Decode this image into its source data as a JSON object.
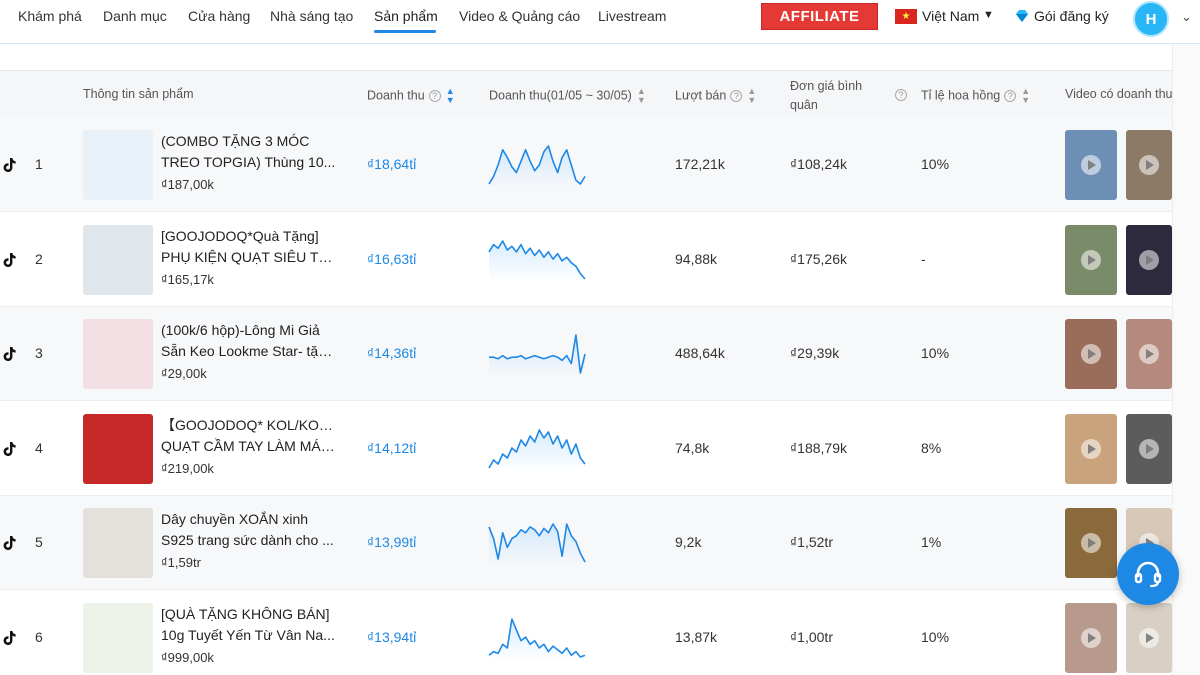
{
  "nav": {
    "items": [
      "Khám phá",
      "Danh mục",
      "Cửa hàng",
      "Nhà sáng tạo",
      "Sản phẩm",
      "Video & Quảng cáo",
      "Livestream"
    ],
    "active": "Sản phẩm",
    "affiliate_label": "AFFILIATE",
    "country": "Việt Nam",
    "plan_label": "Gói đăng ký",
    "avatar_letter": "H"
  },
  "table": {
    "headers": {
      "product_info": "Thông tin sản phẩm",
      "revenue": "Doanh thu",
      "revenue_period": "Doanh thu(01/05 ~ 30/05)",
      "sold": "Lượt bán",
      "unit_price_line1": "Đơn giá bình",
      "unit_price_line2": "quân",
      "commission": "Tỉ lệ hoa hồng",
      "video": "Video có doanh thu"
    },
    "rows": [
      {
        "rank": "1",
        "name_line1": "(COMBO TẶNG 3 MÓC",
        "name_line2": "TREO TOPGIA) Thùng 10...",
        "price": "₫187,00k",
        "revenue": "₫18,64tỉ",
        "trend": [
          8,
          12,
          18,
          26,
          22,
          17,
          14,
          20,
          26,
          20,
          15,
          18,
          25,
          28,
          20,
          14,
          22,
          26,
          18,
          10,
          8,
          12
        ],
        "sold": "172,21k",
        "unit_price": "₫108,24k",
        "commission": "10%",
        "thumb_color": "#e8f0f8",
        "vid1_color": "#6d8fb6",
        "vid2_color": "#8c7a66"
      },
      {
        "rank": "2",
        "name_line1": "[GOOJODOQ*Quà Tặng]",
        "name_line2": "PHỤ KIỆN QUẠT SIÊU TỐC...",
        "price": "₫165,17k",
        "revenue": "₫16,63tỉ",
        "trend": [
          20,
          24,
          22,
          26,
          21,
          23,
          20,
          24,
          19,
          22,
          18,
          21,
          17,
          20,
          16,
          19,
          15,
          17,
          14,
          12,
          8,
          5
        ],
        "sold": "94,88k",
        "unit_price": "₫175,26k",
        "commission": "-",
        "thumb_color": "#dfe6ec",
        "vid1_color": "#7a8b6a",
        "vid2_color": "#2c2a3c"
      },
      {
        "rank": "3",
        "name_line1": "(100k/6 hộp)-Lông Mi Giả",
        "name_line2": "Sẵn Keo Lookme Star- tặn...",
        "price": "₫29,00k",
        "revenue": "₫14,36tỉ",
        "trend": [
          14,
          14,
          13,
          15,
          13,
          14,
          14,
          15,
          13,
          14,
          15,
          14,
          13,
          14,
          15,
          14,
          12,
          15,
          10,
          28,
          4,
          16
        ],
        "sold": "488,64k",
        "unit_price": "₫29,39k",
        "commission": "10%",
        "thumb_color": "#f3dfe3",
        "vid1_color": "#9a6d5a",
        "vid2_color": "#b58a7c"
      },
      {
        "rank": "4",
        "name_line1": "【GOOJODOQ* KOL/KOC】",
        "name_line2": "QUẠT CẦM TAY LÀM MÁT...",
        "price": "₫219,00k",
        "revenue": "₫14,12tỉ",
        "trend": [
          8,
          12,
          10,
          15,
          13,
          18,
          16,
          22,
          19,
          24,
          21,
          27,
          23,
          26,
          20,
          24,
          18,
          22,
          15,
          20,
          13,
          10
        ],
        "sold": "74,8k",
        "unit_price": "₫188,79k",
        "commission": "8%",
        "thumb_color": "#c62828",
        "vid1_color": "#c9a37c",
        "vid2_color": "#5c5c5c"
      },
      {
        "rank": "5",
        "name_line1": "Dây chuyền XOẮN xinh",
        "name_line2": "S925 trang sức dành cho ...",
        "price": "₫1,59tr",
        "revenue": "₫13,99tỉ",
        "trend": [
          28,
          20,
          6,
          24,
          14,
          20,
          22,
          26,
          24,
          28,
          26,
          22,
          27,
          24,
          30,
          25,
          8,
          30,
          22,
          18,
          10,
          4
        ],
        "sold": "9,2k",
        "unit_price": "₫1,52tr",
        "commission": "1%",
        "thumb_color": "#e4e0dc",
        "vid1_color": "#8a6a3a",
        "vid2_color": "#d8c8b8"
      },
      {
        "rank": "6",
        "name_line1": "[QUÀ TẶNG KHÔNG BÁN]",
        "name_line2": "10g Tuyết Yến Từ Vân Na...",
        "price": "₫999,00k",
        "revenue": "₫13,94tỉ",
        "trend": [
          8,
          10,
          9,
          14,
          12,
          28,
          22,
          16,
          18,
          14,
          16,
          12,
          14,
          10,
          13,
          11,
          9,
          12,
          8,
          10,
          7,
          8
        ],
        "sold": "13,87k",
        "unit_price": "₫1,00tr",
        "commission": "10%",
        "thumb_color": "#eef3ea",
        "vid1_color": "#b89a8c",
        "vid2_color": "#d8d0c4"
      }
    ]
  },
  "colors": {
    "accent": "#1e88e5",
    "affiliate_red": "#e53935",
    "avatar": "#29b6f6"
  },
  "icons": {
    "tiktok": "tiktok-icon",
    "help": "help-circle-icon",
    "sort": "sort-icon",
    "gem": "diamond-icon",
    "support": "headset-icon",
    "play": "play-icon"
  }
}
